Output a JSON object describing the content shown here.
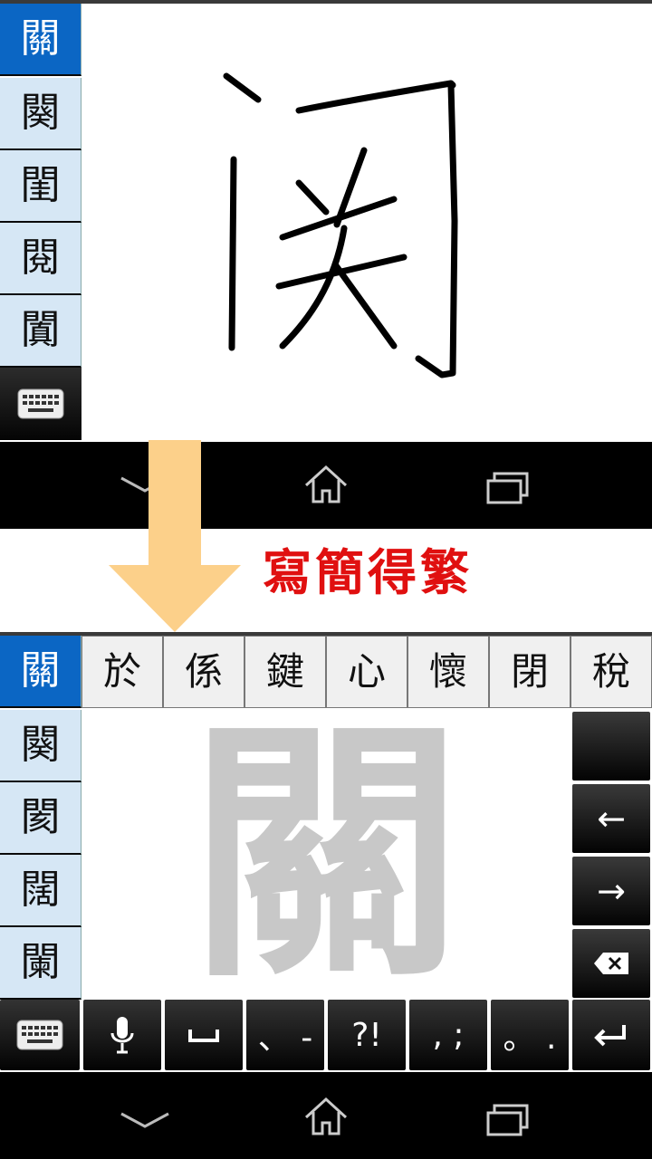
{
  "top_panel": {
    "candidates": [
      "關",
      "闋",
      "閨",
      "閱",
      "闐"
    ],
    "keyboard_icon": "keyboard-icon"
  },
  "caption": "寫簡得繁",
  "bottom_panel": {
    "selected_candidate": "關",
    "side_candidates": [
      "闋",
      "閡",
      "闊",
      "闌"
    ],
    "row_candidates": [
      "於",
      "係",
      "鍵",
      "心",
      "懷",
      "閉",
      "稅"
    ],
    "ghost_char": "關",
    "function_keys": {
      "left_arrow": "←",
      "right_arrow": "→"
    },
    "bottom_keys": {
      "punct1": "、 -",
      "punct2": "?!",
      "punct3": ", ;",
      "punct4": "。 ."
    }
  },
  "colors": {
    "selected_bg": "#0b66c4",
    "candidate_bg": "#d6e7f5",
    "caption": "#e01010",
    "arrow": "#fcd08a"
  }
}
